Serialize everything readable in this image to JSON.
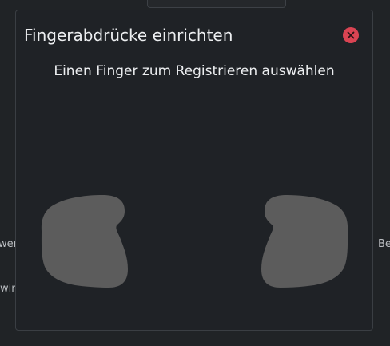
{
  "background": {
    "left_text_1": "wen",
    "left_text_2": "wird",
    "right_text_1": "Be"
  },
  "dialog": {
    "title": "Fingerabdrücke einrichten",
    "instruction": "Einen Finger zum Registrieren auswählen",
    "close_icon": "close-circle-icon",
    "hands": [
      {
        "name": "left-hand",
        "color": "#5c5c5c"
      },
      {
        "name": "right-hand",
        "color": "#5c5c5c"
      }
    ]
  },
  "colors": {
    "window_background": "#202326",
    "dialog_background": "#1f2226",
    "close_button": "#da4453",
    "hand_fill": "#5c5c5c",
    "text": "#eceef0"
  }
}
